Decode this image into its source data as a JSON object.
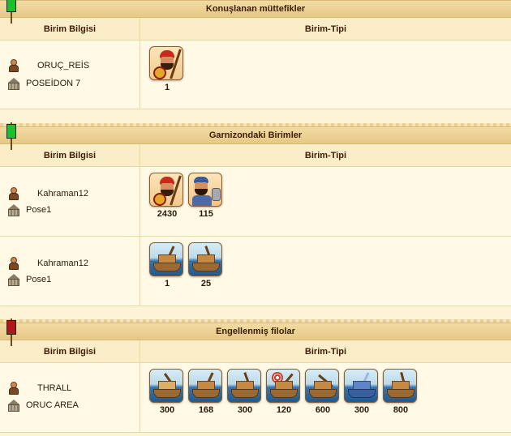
{
  "colors": {
    "flag_allies": "#1fbf2a",
    "flag_garrison": "#1fbf2a",
    "flag_blocked": "#b01818"
  },
  "sections": [
    {
      "title": "Konuşlanan müttefikler",
      "flag": "green",
      "col_info": "Birim Bilgisi",
      "col_type": "Birim-Tipi",
      "rows": [
        {
          "player": "ORUÇ_REİS",
          "city": "POSEİDON 7",
          "units": [
            {
              "icon": "hoplite-icon",
              "count": "1"
            }
          ]
        }
      ]
    },
    {
      "title": "Garnizondaki Birimler",
      "flag": "green",
      "col_info": "Birim Bilgisi",
      "col_type": "Birim-Tipi",
      "rows": [
        {
          "player": "Kahraman12",
          "city": "Pose1",
          "units": [
            {
              "icon": "hoplite-icon",
              "count": "2430"
            },
            {
              "icon": "slinger-icon",
              "count": "115"
            }
          ]
        },
        {
          "player": "Kahraman12",
          "city": "Pose1",
          "units": [
            {
              "icon": "ram-ship-icon",
              "count": "1"
            },
            {
              "icon": "catapult-ship-icon",
              "count": "25"
            }
          ]
        }
      ]
    },
    {
      "title": "Engellenmiş filolar",
      "flag": "red",
      "col_info": "Birim Bilgisi",
      "col_type": "Birim-Tipi",
      "rows": [
        {
          "player": "THRALL",
          "city": "ORUC AREA",
          "units": [
            {
              "icon": "transport-ship-icon",
              "count": "300"
            },
            {
              "icon": "ram-ship-icon",
              "count": "168"
            },
            {
              "icon": "catapult-ship-icon",
              "count": "300"
            },
            {
              "icon": "target-ship-icon",
              "count": "120"
            },
            {
              "icon": "ballista-ship-icon",
              "count": "600"
            },
            {
              "icon": "fire-ship-icon",
              "count": "300"
            },
            {
              "icon": "bireme-ship-icon",
              "count": "800"
            }
          ]
        }
      ]
    }
  ]
}
